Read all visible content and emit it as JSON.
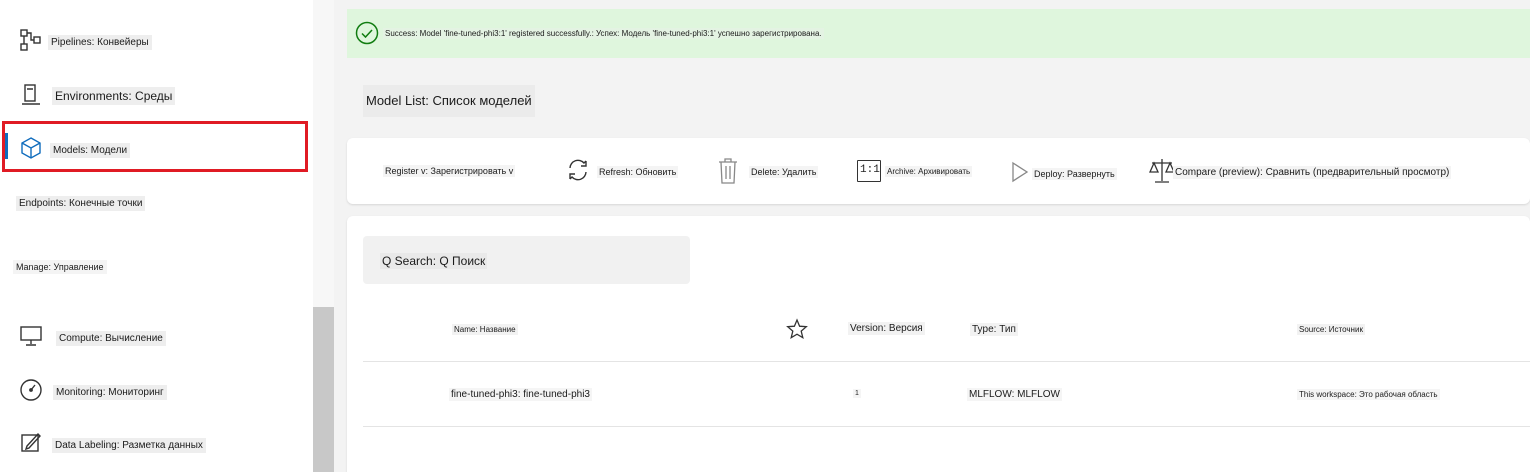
{
  "sidebar": {
    "items": [
      {
        "label": "Pipelines: Конвейеры",
        "icon": "pipelines-icon"
      },
      {
        "label": "Environments: Среды",
        "icon": "environments-icon"
      },
      {
        "label": "Models: Модели",
        "icon": "models-icon",
        "selected": true
      },
      {
        "label": "Endpoints: Конечные точки",
        "icon": "endpoints-icon"
      },
      {
        "label": "Manage: Управление"
      },
      {
        "label": "Compute: Вычисление",
        "icon": "compute-icon"
      },
      {
        "label": "Monitoring: Мониторинг",
        "icon": "monitoring-icon"
      },
      {
        "label": "Data Labeling: Разметка данных",
        "icon": "data-labeling-icon"
      }
    ]
  },
  "banner": {
    "text": "Success: Model 'fine-tuned-phi3:1' registered successfully.: Успех: Модель 'fine-tuned-phi3:1' успешно зарегистрирована.",
    "icon": "success-check-icon",
    "color": "#dff6dd"
  },
  "page": {
    "title": "Model List: Список моделей"
  },
  "toolbar": {
    "register_label": "Register v: Зарегистрировать v",
    "refresh_label": "Refresh: Обновить",
    "delete_label": "Delete: Удалить",
    "archive_icon_text": "1:1",
    "archive_label": "Archive: Архивировать",
    "deploy_label": "Deploy: Развернуть",
    "compare_label": "Compare (preview): Сравнить (предварительный просмотр)"
  },
  "search": {
    "placeholder": "Q Search: Q Поиск"
  },
  "table": {
    "columns": [
      "Name: Название",
      "Version: Версия",
      "Type: Тип",
      "Source: Источник"
    ],
    "rows": [
      {
        "name": "fine-tuned-phi3: fine-tuned-phi3",
        "version": "1",
        "type": "MLFLOW: MLFLOW",
        "source": "This workspace: Это рабочая область"
      }
    ]
  },
  "colors": {
    "accent": "#0f6cbd",
    "highlight_border": "#e01b24",
    "success_bg": "#dff6dd",
    "success_icon": "#107c10"
  }
}
